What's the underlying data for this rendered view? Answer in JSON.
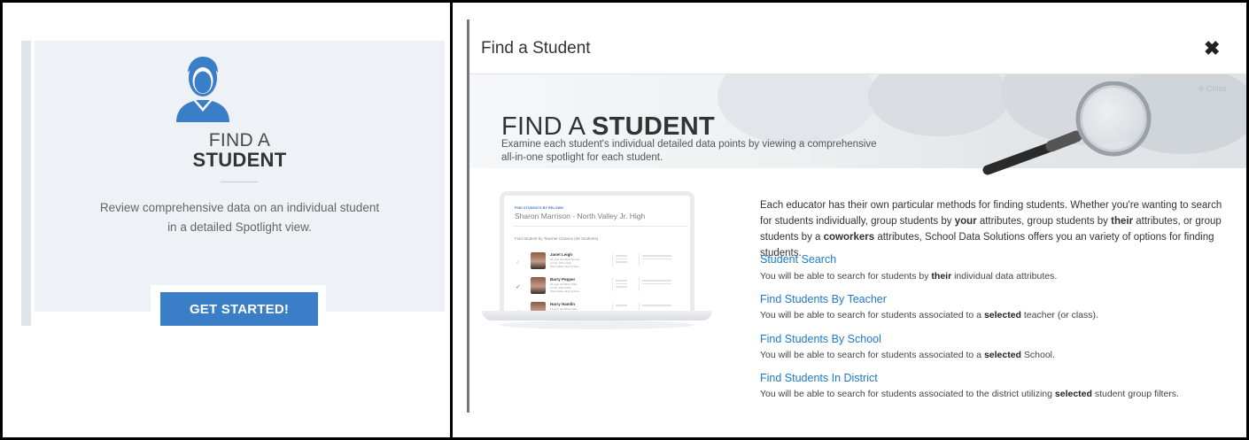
{
  "left_card": {
    "title_top": "FIND A",
    "title_bottom": "STUDENT",
    "description": "Review comprehensive data on an individual student in a detailed Spotlight view.",
    "cta_label": "GET STARTED!",
    "icon": "student-avatar-icon"
  },
  "modal": {
    "title": "Find a Student",
    "close_glyph": "✖",
    "hero": {
      "close_label": "⊗ Close",
      "title_light": "FIND A ",
      "title_bold": "STUDENT",
      "subtitle_line1": "Examine each student's individual detailed data points by viewing a comprehensive",
      "subtitle_line2": "all-in-one spotlight for each student."
    },
    "laptop_preview": {
      "label": "FIND STUDENTS BY RELOWN",
      "name": "Sharon Marrison - North Valley Jr. High",
      "filter": "Find Student by Teacher Classes (46 Students)",
      "rows": [
        {
          "name": "Janet Leigh",
          "meta1": "15 year old White female",
          "meta2": "Lunch: 100 rudder",
          "meta3": "West Valley High School",
          "checked": false
        },
        {
          "name": "Barry Pepper",
          "meta1": "15 year old White Male",
          "meta2": "Lunch: 100 rudder",
          "meta3": "West Valley High School",
          "checked": true
        },
        {
          "name": "Harry Hamlin",
          "meta1": "15 year old White Male",
          "meta2": "",
          "meta3": "",
          "checked": false
        }
      ]
    },
    "intro_parts": [
      "Each educator has their own particular methods for finding students. Whether you're wanting to search for students individually, group students by ",
      "your",
      " attributes, group students by ",
      "their",
      " attributes, or group students by a ",
      "coworkers",
      " attributes, School Data Solutions offers you an variety of options for finding students."
    ],
    "options": [
      {
        "label": "Student Search",
        "desc_before": "You will be able to search for students by ",
        "desc_bold": "their",
        "desc_after": " individual data attributes."
      },
      {
        "label": "Find Students By Teacher",
        "desc_before": "You will be able to search for students associated to a ",
        "desc_bold": "selected",
        "desc_after": " teacher (or class)."
      },
      {
        "label": "Find Students By School",
        "desc_before": "You will be able to search for students associated to a ",
        "desc_bold": "selected",
        "desc_after": " School."
      },
      {
        "label": "Find Students In District",
        "desc_before": "You will be able to search for students associated to the district utilizing ",
        "desc_bold": "selected",
        "desc_after": " student group filters."
      }
    ]
  },
  "colors": {
    "accent_blue": "#3b7ec8",
    "link_blue": "#1f78c9",
    "card_bg": "#eef1f5"
  }
}
